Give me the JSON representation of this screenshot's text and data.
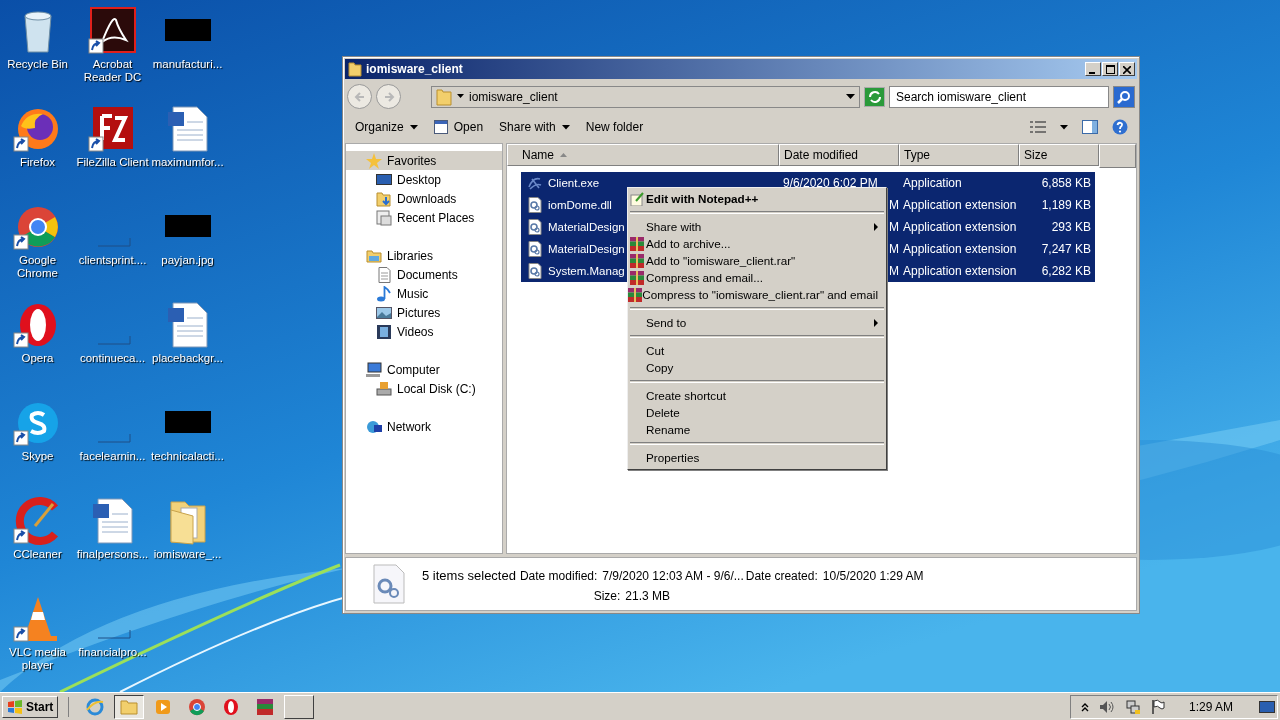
{
  "desktop": {
    "icons": [
      {
        "label": "Recycle Bin",
        "kind": "recycle",
        "shortcut": false
      },
      {
        "label": "Firefox",
        "kind": "firefox",
        "shortcut": true
      },
      {
        "label": "Google Chrome",
        "kind": "chrome",
        "shortcut": true
      },
      {
        "label": "Opera",
        "kind": "opera",
        "shortcut": true
      },
      {
        "label": "Skype",
        "kind": "skype",
        "shortcut": true
      },
      {
        "label": "CCleaner",
        "kind": "ccleaner",
        "shortcut": true
      },
      {
        "label": "VLC media player",
        "kind": "vlc",
        "shortcut": true
      },
      {
        "label": "Acrobat Reader DC",
        "kind": "acrobat",
        "shortcut": true
      },
      {
        "label": "FileZilla Client",
        "kind": "filezilla",
        "shortcut": true
      },
      {
        "label": "clientsprint....",
        "kind": "blank",
        "shortcut": false
      },
      {
        "label": "continueca...",
        "kind": "blank",
        "shortcut": false
      },
      {
        "label": "facelearnin...",
        "kind": "blank",
        "shortcut": false
      },
      {
        "label": "finalpersons...",
        "kind": "word",
        "shortcut": false
      },
      {
        "label": "financialpro...",
        "kind": "blank",
        "shortcut": false
      },
      {
        "label": "manufacturi...",
        "kind": "thumb",
        "shortcut": false
      },
      {
        "label": "maximumfor...",
        "kind": "word",
        "shortcut": false
      },
      {
        "label": "payjan.jpg",
        "kind": "thumb",
        "shortcut": false
      },
      {
        "label": "placebackgr...",
        "kind": "word",
        "shortcut": false
      },
      {
        "label": "technicalacti...",
        "kind": "thumb",
        "shortcut": false
      },
      {
        "label": "iomisware_...",
        "kind": "folder",
        "shortcut": false
      }
    ]
  },
  "window": {
    "title": "iomisware_client",
    "address": "iomisware_client",
    "search": {
      "placeholder": "Search iomisware_client"
    },
    "toolbar": [
      {
        "label": "Organize",
        "kind": "dropdown"
      },
      {
        "label": "Open",
        "kind": "open"
      },
      {
        "label": "Share with",
        "kind": "dropdown"
      },
      {
        "label": "New folder",
        "kind": "plain"
      }
    ],
    "nav": [
      {
        "label": "Favorites",
        "kind": "star",
        "selected": true,
        "children": [
          {
            "label": "Desktop",
            "kind": "desktop",
            "selected": false
          },
          {
            "label": "Downloads",
            "kind": "downloads",
            "selected": false
          },
          {
            "label": "Recent Places",
            "kind": "recent",
            "selected": false
          }
        ]
      },
      {
        "label": "Libraries",
        "kind": "library",
        "selected": false,
        "children": [
          {
            "label": "Documents",
            "kind": "documents",
            "selected": false
          },
          {
            "label": "Music",
            "kind": "music",
            "selected": false
          },
          {
            "label": "Pictures",
            "kind": "pictures",
            "selected": false
          },
          {
            "label": "Videos",
            "kind": "videos",
            "selected": false
          }
        ]
      },
      {
        "label": "Computer",
        "kind": "computer",
        "selected": false,
        "children": [
          {
            "label": "Local Disk (C:)",
            "kind": "disk",
            "selected": false
          }
        ]
      },
      {
        "label": "Network",
        "kind": "network",
        "selected": false
      }
    ],
    "columns": [
      {
        "label": "Name",
        "sorted": true
      },
      {
        "label": "Date modified",
        "sorted": false
      },
      {
        "label": "Type",
        "sorted": false
      },
      {
        "label": "Size",
        "sorted": false
      }
    ],
    "rows": [
      {
        "kind": "exe",
        "name": "Client.exe",
        "date": "9/6/2020 6:02 PM",
        "type": "Application",
        "size": "6,858 KB",
        "selected": true
      },
      {
        "kind": "dll",
        "name": "iomDome.dll",
        "date": "M",
        "type": "Application extension",
        "size": "1,189 KB",
        "selected": true
      },
      {
        "kind": "dll",
        "name": "MaterialDesign",
        "date": "M",
        "type": "Application extension",
        "size": "293 KB",
        "selected": true
      },
      {
        "kind": "dll",
        "name": "MaterialDesign",
        "date": "M",
        "type": "Application extension",
        "size": "7,247 KB",
        "selected": true
      },
      {
        "kind": "dll",
        "name": "System.Manag",
        "date": "M",
        "type": "Application extension",
        "size": "6,282 KB",
        "selected": true
      }
    ],
    "context_menu": [
      {
        "kind": "default",
        "label": "Edit with Notepad++"
      },
      {
        "kind": "separator"
      },
      {
        "kind": "submenu",
        "label": "Share with"
      },
      {
        "kind": "archive",
        "label": "Add to archive..."
      },
      {
        "kind": "archive",
        "label": "Add to \"iomisware_client.rar\""
      },
      {
        "kind": "archive",
        "label": "Compress and email..."
      },
      {
        "kind": "archive",
        "label": "Compress to \"iomisware_client.rar\" and email"
      },
      {
        "kind": "separator"
      },
      {
        "kind": "submenu",
        "label": "Send to"
      },
      {
        "kind": "separator"
      },
      {
        "kind": "plain",
        "label": "Cut"
      },
      {
        "kind": "plain",
        "label": "Copy"
      },
      {
        "kind": "separator"
      },
      {
        "kind": "plain",
        "label": "Create shortcut"
      },
      {
        "kind": "plain",
        "label": "Delete"
      },
      {
        "kind": "plain",
        "label": "Rename"
      },
      {
        "kind": "separator"
      },
      {
        "kind": "plain",
        "label": "Properties"
      }
    ],
    "details": {
      "summary": "5 items selected",
      "fields": [
        {
          "label": "Date modified:",
          "value": "7/9/2020 12:03 AM - 9/6/..."
        },
        {
          "label": "Date created:",
          "value": "10/5/2020 1:29 AM"
        },
        {
          "label": "Size:",
          "value": "21.3 MB"
        }
      ]
    }
  },
  "taskbar": {
    "start": "Start",
    "apps": [
      {
        "kind": "ie",
        "active": false
      },
      {
        "kind": "explorer",
        "active": true
      },
      {
        "kind": "media",
        "active": false
      },
      {
        "kind": "chrome",
        "active": false
      },
      {
        "kind": "opera",
        "active": false
      },
      {
        "kind": "winrar",
        "active": false
      },
      {
        "kind": "window",
        "active": false
      }
    ],
    "clock": "1:29 AM"
  }
}
